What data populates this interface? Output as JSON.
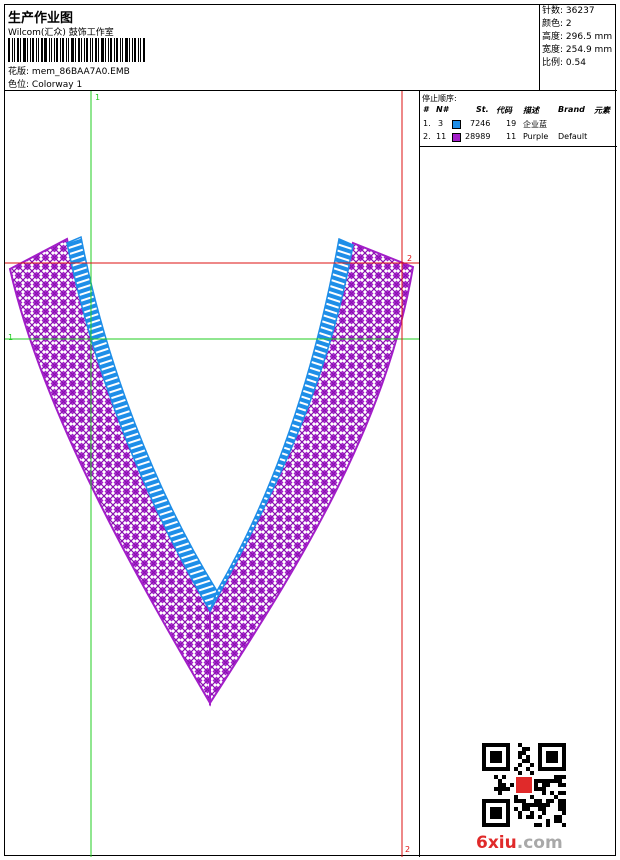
{
  "header": {
    "title": "生产作业图",
    "subtitle": "Wilcom(汇众) 鼓饰工作室",
    "design_label": "花版:",
    "design_value": "mem_86BAA7A0.EMB",
    "colorway_label": "色位:",
    "colorway_value": "Colorway 1"
  },
  "stats": [
    {
      "label": "针数:",
      "value": "36237"
    },
    {
      "label": "颜色:",
      "value": "2"
    },
    {
      "label": "高度:",
      "value": "296.5 mm"
    },
    {
      "label": "宽度:",
      "value": "254.9 mm"
    },
    {
      "label": "比例:",
      "value": "0.54"
    }
  ],
  "stop_sequence": {
    "title": "停止顺序:",
    "columns": [
      "#",
      "N#",
      "St.",
      "代码",
      "描述",
      "Brand",
      "元素"
    ],
    "rows": [
      {
        "index": "1.",
        "needle": "3",
        "color": "#1e8ee8",
        "stitches": "7246",
        "code": "19",
        "description": "企业蓝",
        "brand": ""
      },
      {
        "index": "2.",
        "needle": "11",
        "color": "#a21ec8",
        "stitches": "28989",
        "code": "11",
        "description": "Purple",
        "brand": "Default"
      }
    ]
  },
  "guides": {
    "green_label_top": "1",
    "green_label_left": "1",
    "red_label_right": "2",
    "red_label_bottom": "2"
  },
  "colors": {
    "blue_thread": "#1e8ee8",
    "purple_thread": "#a21ec8",
    "guide_green": "#22cc22",
    "guide_red": "#dd1111"
  },
  "watermark": {
    "text_red": "6xiu",
    "text_grey": ".com"
  }
}
